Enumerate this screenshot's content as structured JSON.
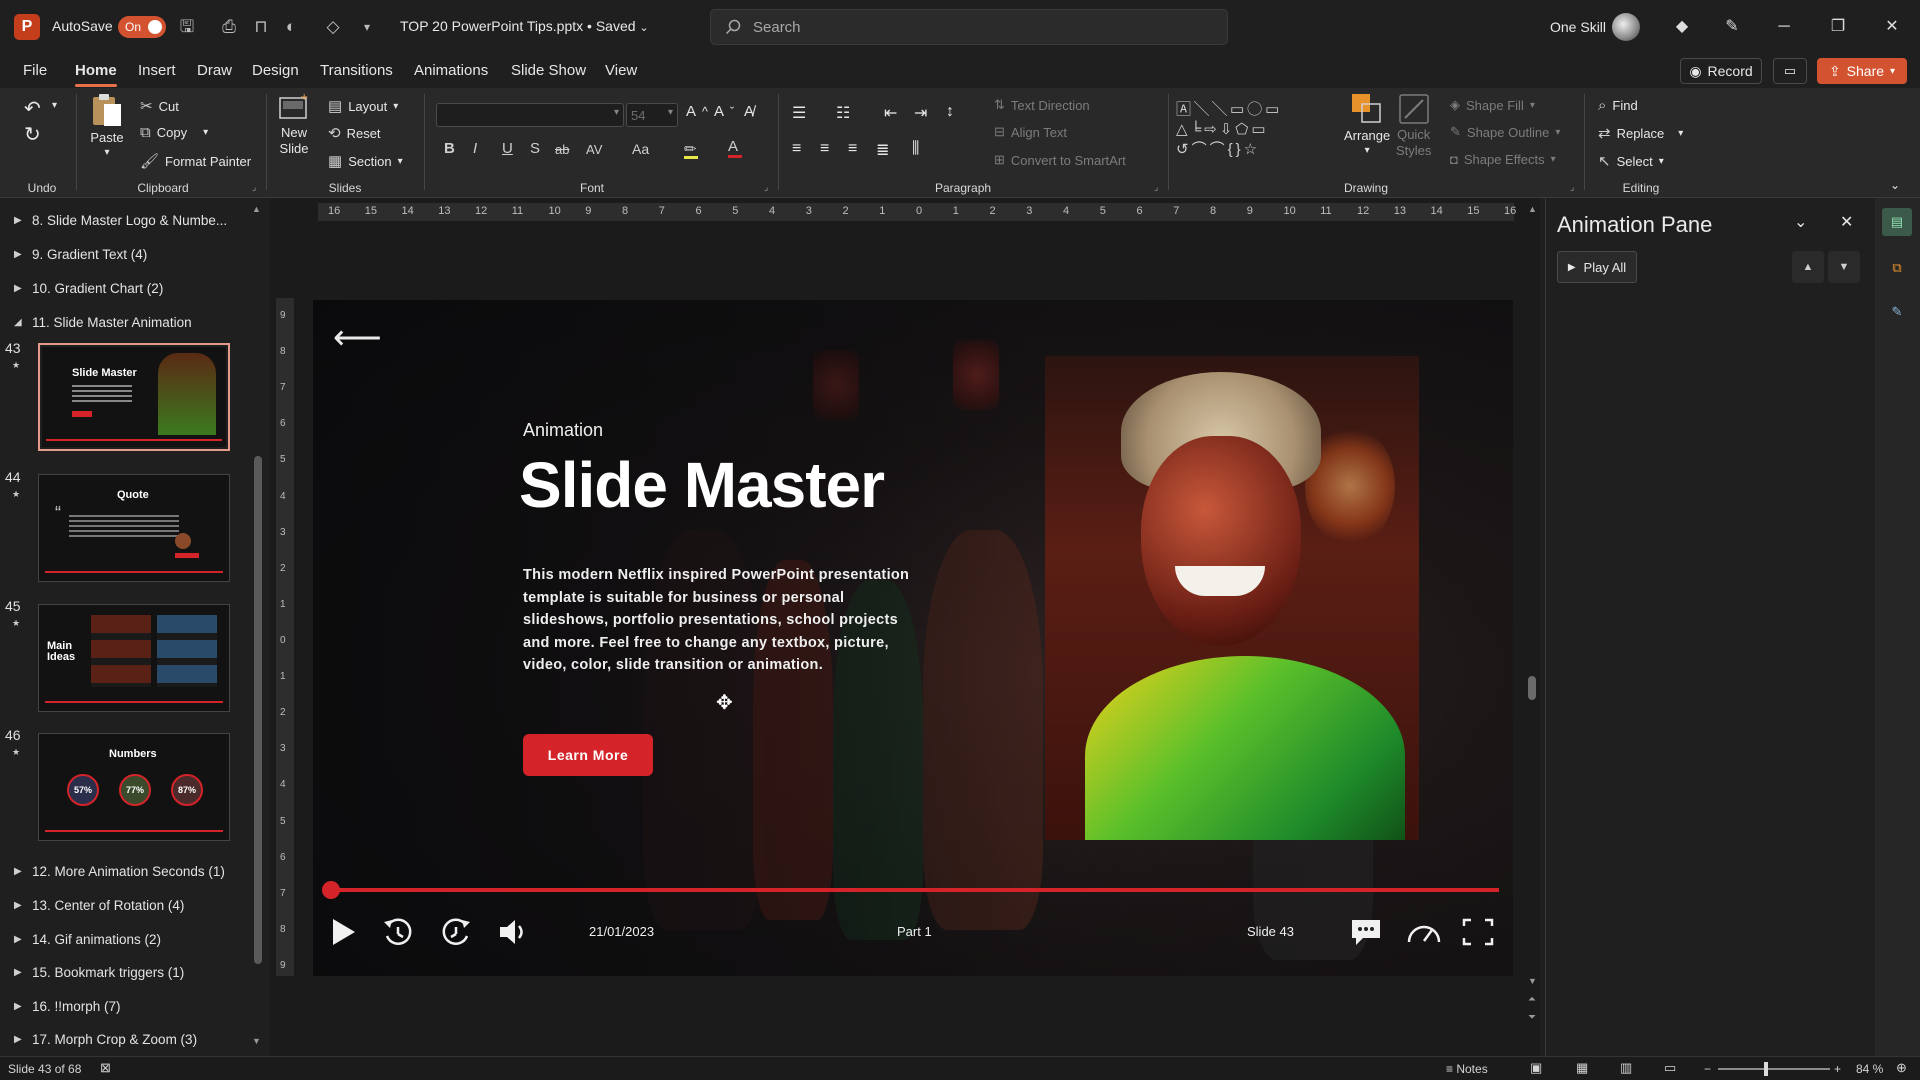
{
  "app": {
    "logo_letter": "P",
    "autosave_label": "AutoSave",
    "autosave_state": "On",
    "doc_title": "TOP 20 PowerPoint Tips.pptx • Saved",
    "search_placeholder": "Search",
    "user_name": "One Skill"
  },
  "menu": {
    "tabs": [
      "File",
      "Home",
      "Insert",
      "Draw",
      "Design",
      "Transitions",
      "Animations",
      "Slide Show",
      "View"
    ],
    "active": "Home",
    "record_label": "Record",
    "share_label": "Share"
  },
  "ribbon": {
    "undo_group": "Undo",
    "clipboard": {
      "group": "Clipboard",
      "paste": "Paste",
      "cut": "Cut",
      "copy": "Copy",
      "format_painter": "Format Painter"
    },
    "slides": {
      "group": "Slides",
      "new_slide_1": "New",
      "new_slide_2": "Slide",
      "layout": "Layout",
      "reset": "Reset",
      "section": "Section"
    },
    "font": {
      "group": "Font",
      "size": "54",
      "bold": "B",
      "italic": "I",
      "underline": "U",
      "shadow": "S",
      "strike": "ab",
      "spacing": "AV",
      "case": "Aa"
    },
    "paragraph": {
      "group": "Paragraph",
      "text_direction": "Text Direction",
      "align_text": "Align Text",
      "convert_smartart": "Convert to SmartArt"
    },
    "drawing": {
      "group": "Drawing",
      "arrange": "Arrange",
      "quick_styles_1": "Quick",
      "quick_styles_2": "Styles",
      "shape_fill": "Shape Fill",
      "shape_outline": "Shape Outline",
      "shape_effects": "Shape Effects"
    },
    "editing": {
      "group": "Editing",
      "find": "Find",
      "replace": "Replace",
      "select": "Select"
    }
  },
  "sections": {
    "top": [
      {
        "label": "8. Slide Master Logo & Numbe...",
        "expanded": false
      },
      {
        "label": "9. Gradient Text (4)",
        "expanded": false
      },
      {
        "label": "10. Gradient Chart (2)",
        "expanded": false
      },
      {
        "label": "11. Slide Master Animation",
        "expanded": true
      }
    ],
    "bottom": [
      {
        "label": "12. More Animation Seconds (1)"
      },
      {
        "label": "13. Center of Rotation (4)"
      },
      {
        "label": "14. Gif animations (2)"
      },
      {
        "label": "15. Bookmark triggers (1)"
      },
      {
        "label": "16. !!morph (7)"
      },
      {
        "label": "17. Morph Crop & Zoom (3)"
      }
    ]
  },
  "thumbnails": [
    {
      "num": "43",
      "title": "Slide Master",
      "selected": true
    },
    {
      "num": "44",
      "title": "Quote",
      "selected": false
    },
    {
      "num": "45",
      "title": "Main Ideas",
      "selected": false
    },
    {
      "num": "46",
      "title": "Numbers",
      "selected": false,
      "stats": [
        "57%",
        "77%",
        "87%"
      ]
    }
  ],
  "rulers": {
    "horizontal": [
      "16",
      "15",
      "14",
      "13",
      "12",
      "11",
      "10",
      "9",
      "8",
      "7",
      "6",
      "5",
      "4",
      "3",
      "2",
      "1",
      "0",
      "1",
      "2",
      "3",
      "4",
      "5",
      "6",
      "7",
      "8",
      "9",
      "10",
      "11",
      "12",
      "13",
      "14",
      "15",
      "16"
    ],
    "vertical": [
      "9",
      "8",
      "7",
      "6",
      "5",
      "4",
      "3",
      "2",
      "1",
      "0",
      "1",
      "2",
      "3",
      "4",
      "5",
      "6",
      "7",
      "8",
      "9"
    ]
  },
  "slide": {
    "eyebrow": "Animation",
    "title": "Slide Master",
    "body": "This modern Netflix inspired PowerPoint presentation template is suitable for business or personal slideshows, portfolio presentations, school projects and more. Feel free to change any textbox, picture, video, color, slide transition or animation.",
    "button": "Learn More",
    "date": "21/01/2023",
    "part": "Part 1",
    "slide_label": "Slide 43",
    "accent": "#d4242a"
  },
  "animation_pane": {
    "title": "Animation Pane",
    "play_all": "Play All"
  },
  "status": {
    "slide_count": "Slide 43 of 68",
    "notes": "Notes",
    "zoom": "84 %"
  }
}
